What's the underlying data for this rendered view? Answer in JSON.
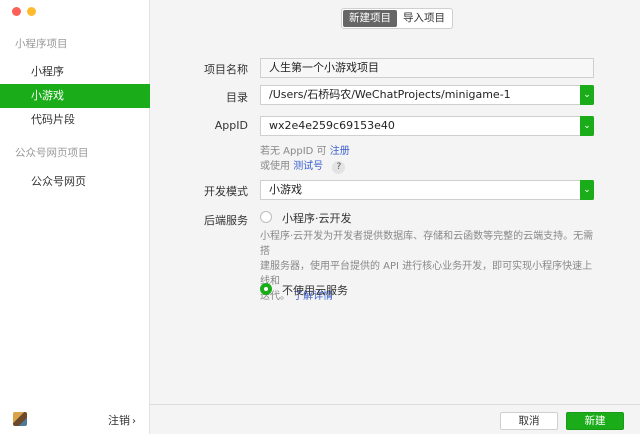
{
  "sidebar": {
    "group1_title": "小程序项目",
    "items": [
      {
        "label": "小程序"
      },
      {
        "label": "小游戏"
      },
      {
        "label": "代码片段"
      }
    ],
    "group2_title": "公众号网页项目",
    "items2": [
      {
        "label": "公众号网页"
      }
    ],
    "logout_label": "注销",
    "logout_chevron": "›"
  },
  "tabs": [
    {
      "label": "新建项目",
      "active": true
    },
    {
      "label": "导入项目",
      "active": false
    }
  ],
  "form": {
    "project_name": {
      "label": "项目名称",
      "value": "人生第一个小游戏项目"
    },
    "directory": {
      "label": "目录",
      "value": "/Users/石桥码农/WeChatProjects/minigame-1"
    },
    "appid": {
      "label": "AppID",
      "value": "wx2e4e259c69153e40"
    },
    "appid_hint1_prefix": "若无 AppID 可",
    "appid_hint1_link": "注册",
    "appid_hint2_prefix": "或使用",
    "appid_hint2_link": "测试号",
    "help_mark": "?",
    "dev_mode": {
      "label": "开发模式",
      "value": "小游戏"
    },
    "backend": {
      "label": "后端服务",
      "option1": "小程序·云开发",
      "option1_desc_line1": "小程序·云开发为开发者提供数据库、存储和云函数等完整的云端支持。无需搭",
      "option1_desc_line2": "建服务器，使用平台提供的 API 进行核心业务开发，即可实现小程序快速上线和",
      "option1_desc_line3": "迭代。",
      "option1_desc_link": "了解详情",
      "option2": "不使用云服务",
      "selected": "option2"
    },
    "dropdown_glyph": "⌄"
  },
  "buttons": {
    "cancel": "取消",
    "create": "新建"
  },
  "colors": {
    "accent": "#1aad19",
    "link": "#3a5fcd"
  }
}
